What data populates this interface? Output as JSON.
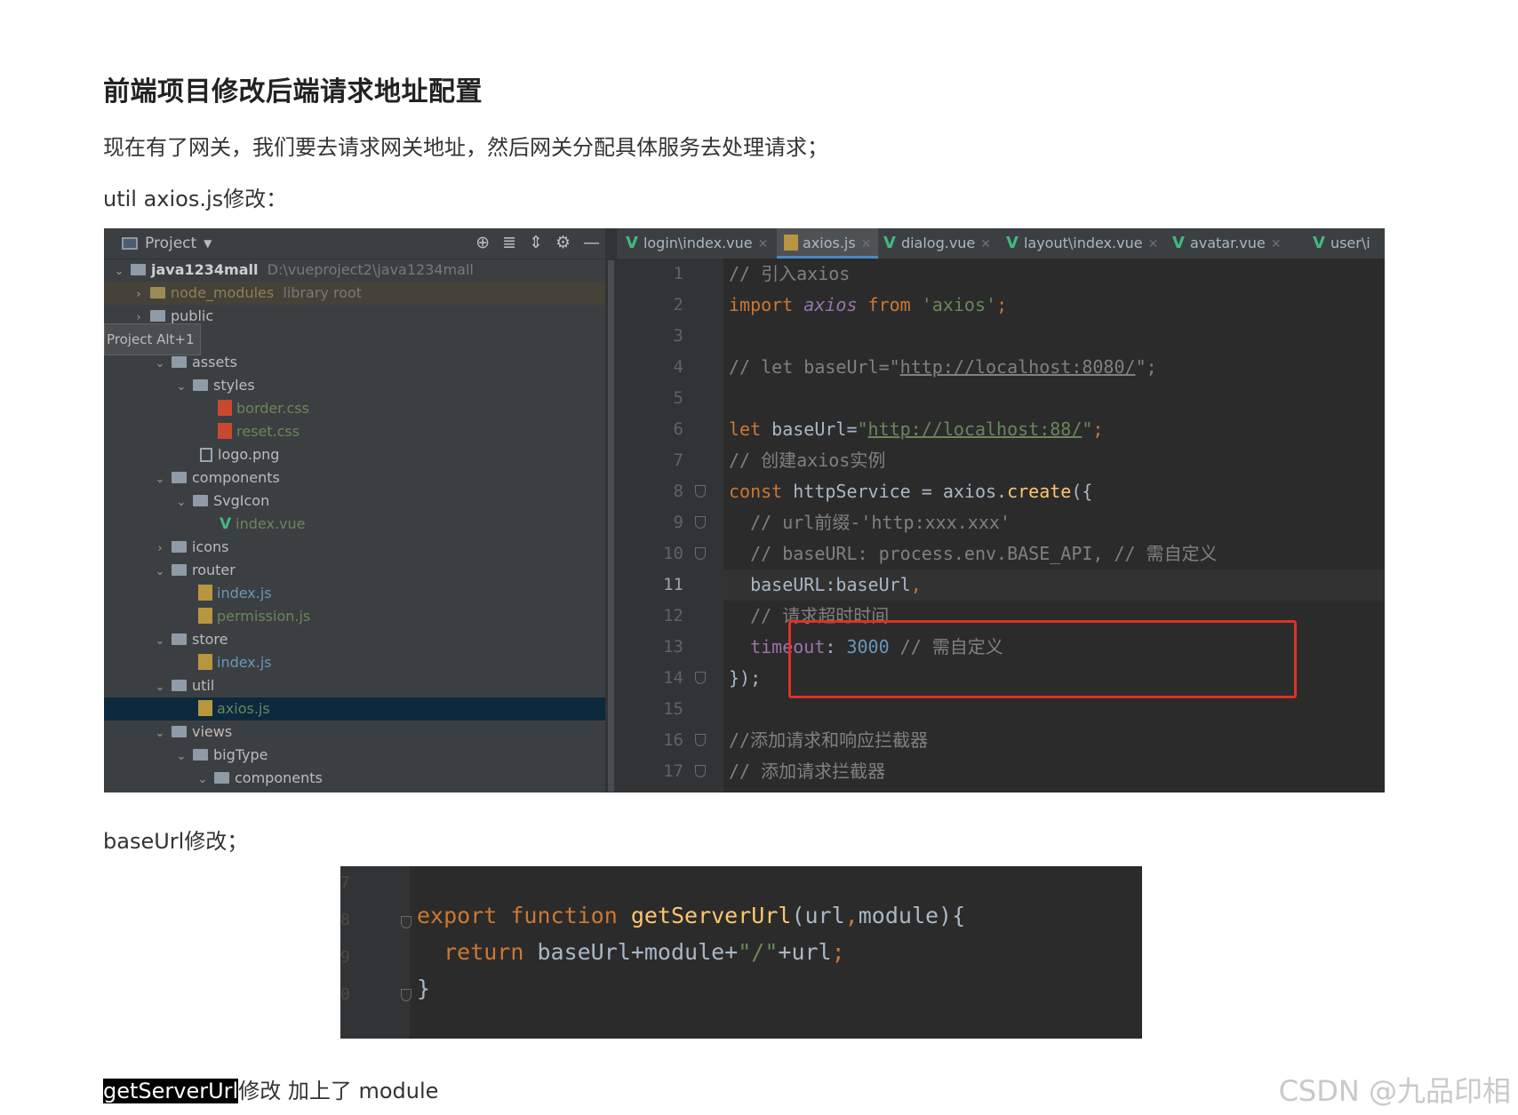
{
  "article": {
    "heading": "前端项目修改后端请求地址配置",
    "para1": "现在有了网关，我们要去请求网关地址，然后网关分配具体服务去处理请求；",
    "para2": "util axios.js修改：",
    "para3": "baseUrl修改；",
    "para4_highlight": "getServerUrl",
    "para4_rest": "修改 加上了 module"
  },
  "ide": {
    "project_label": "Project",
    "tooltip": "Project  Alt+1",
    "tree": [
      {
        "label": "java1234mall",
        "extra": "D:\\vueproject2\\java1234mall"
      },
      {
        "label": "node_modules",
        "extra": "library root"
      },
      {
        "label": "public"
      },
      {
        "label": "assets"
      },
      {
        "label": "styles"
      },
      {
        "label": "border.css"
      },
      {
        "label": "reset.css"
      },
      {
        "label": "logo.png"
      },
      {
        "label": "components"
      },
      {
        "label": "SvgIcon"
      },
      {
        "label": "index.vue"
      },
      {
        "label": "icons"
      },
      {
        "label": "router"
      },
      {
        "label": "index.js"
      },
      {
        "label": "permission.js"
      },
      {
        "label": "store"
      },
      {
        "label": "index.js"
      },
      {
        "label": "util"
      },
      {
        "label": "axios.js"
      },
      {
        "label": "views"
      },
      {
        "label": "bigType"
      },
      {
        "label": "components"
      }
    ],
    "tabs": [
      "login\\index.vue",
      "axios.js",
      "dialog.vue",
      "layout\\index.vue",
      "avatar.vue",
      "user\\i"
    ],
    "line_numbers": [
      "1",
      "2",
      "3",
      "4",
      "5",
      "6",
      "7",
      "8",
      "9",
      "10",
      "11",
      "12",
      "13",
      "14",
      "15",
      "16",
      "17"
    ],
    "code": {
      "l1": "// 引入axios",
      "l2_kw": "import ",
      "l2_id": "axios",
      "l2_from": " from ",
      "l2_str": "'axios'",
      "l2_end": ";",
      "l4_cm": "// let baseUrl=\"",
      "l4_url": "http://localhost:8080/",
      "l4_end": "\";",
      "l6_kw": "let ",
      "l6_id": "baseUrl=",
      "l6_q1": "\"",
      "l6_url": "http://localhost:88/",
      "l6_q2": "\"",
      "l6_semi": ";",
      "l7": "// 创建axios实例",
      "l8_kw": "const ",
      "l8_a": "httpService = axios.",
      "l8_fn": "create",
      "l8_b": "({",
      "l9": "  // url前缀-'http:xxx.xxx'",
      "l10": "  // baseURL: process.env.BASE_API, // 需自定义",
      "l11_prop": "  baseURL",
      "l11_rest": ":baseUrl",
      "l11_comma": ",",
      "l12": "  // 请求超时时间",
      "l13_prop": "  timeout",
      "l13_colon": ": ",
      "l13_num": "3000",
      "l13_cm": " // 需自定义",
      "l14": "});",
      "l16": "//添加请求和响应拦截器",
      "l17": "// 添加请求拦截器"
    }
  },
  "ide2": {
    "gutter": [
      "7",
      "8",
      "9",
      "0"
    ],
    "l1_kw": "export function ",
    "l1_fn": "getServerUrl",
    "l1_rest": "(url",
    "l1_comma": ",",
    "l1_rest2": "module){",
    "l2_kw": "  return ",
    "l2_a": "baseUrl+module+",
    "l2_str": "\"/\"",
    "l2_b": "+url",
    "l2_semi": ";",
    "l3": "}"
  },
  "watermark": "CSDN @九品印相"
}
